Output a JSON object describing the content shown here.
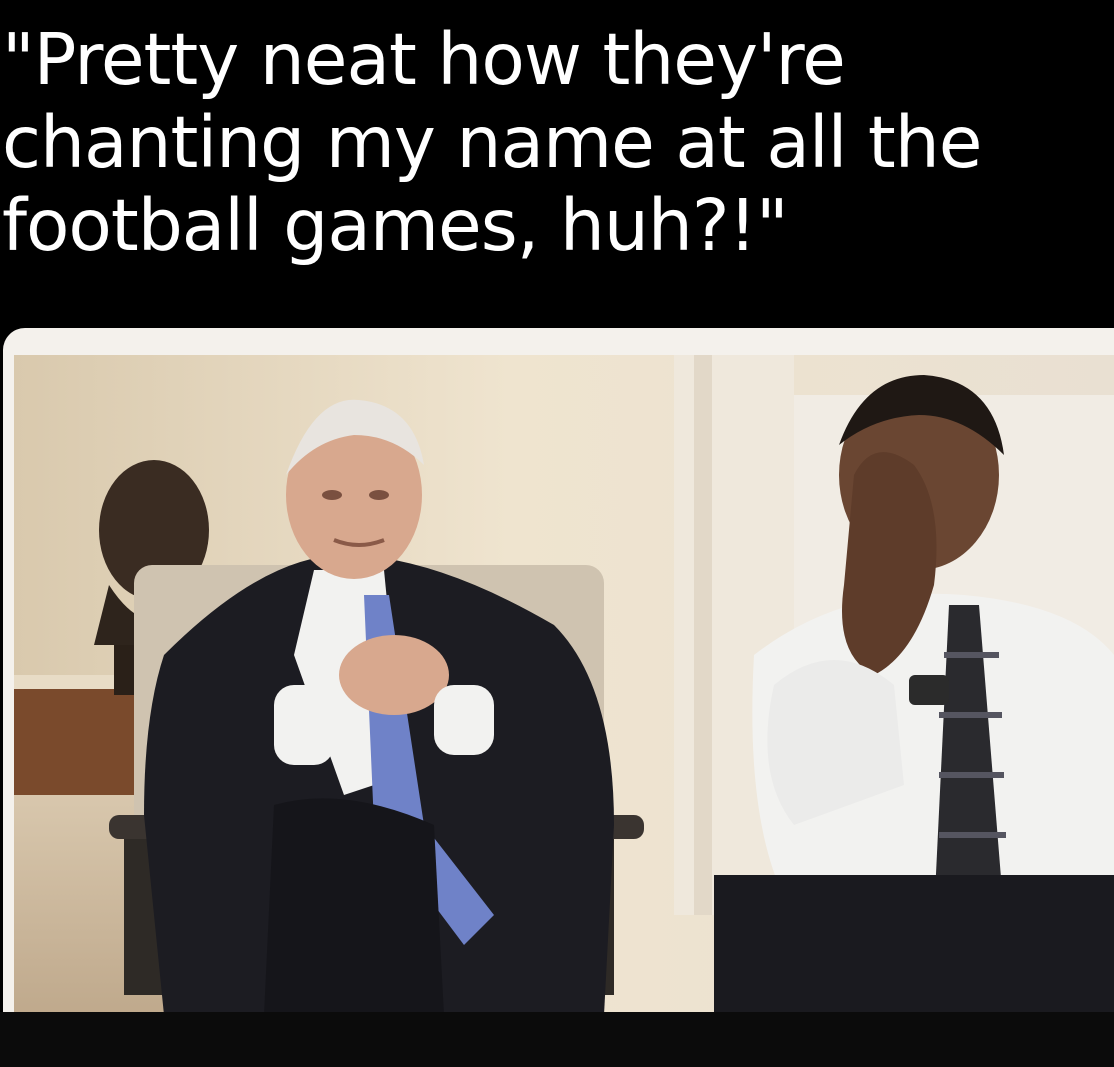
{
  "caption": {
    "lines": [
      "\"Pretty neat how they're",
      "chanting my name at all the",
      "football games, huh?!\""
    ]
  },
  "photo": {
    "alt": "Two men in suits seated in an office; one leans back with hands clasped, the other covers his face with both hands",
    "colors": {
      "wall": "#e6d9c2",
      "suit": "#1c1c22",
      "white_shirt": "#f2f2f0",
      "blue_tie": "#6f82c8",
      "striped_tie": "#2a2a2e",
      "skin_light": "#d8a88e",
      "skin_dark": "#6a4632",
      "floor": "#c9b9a2"
    }
  }
}
